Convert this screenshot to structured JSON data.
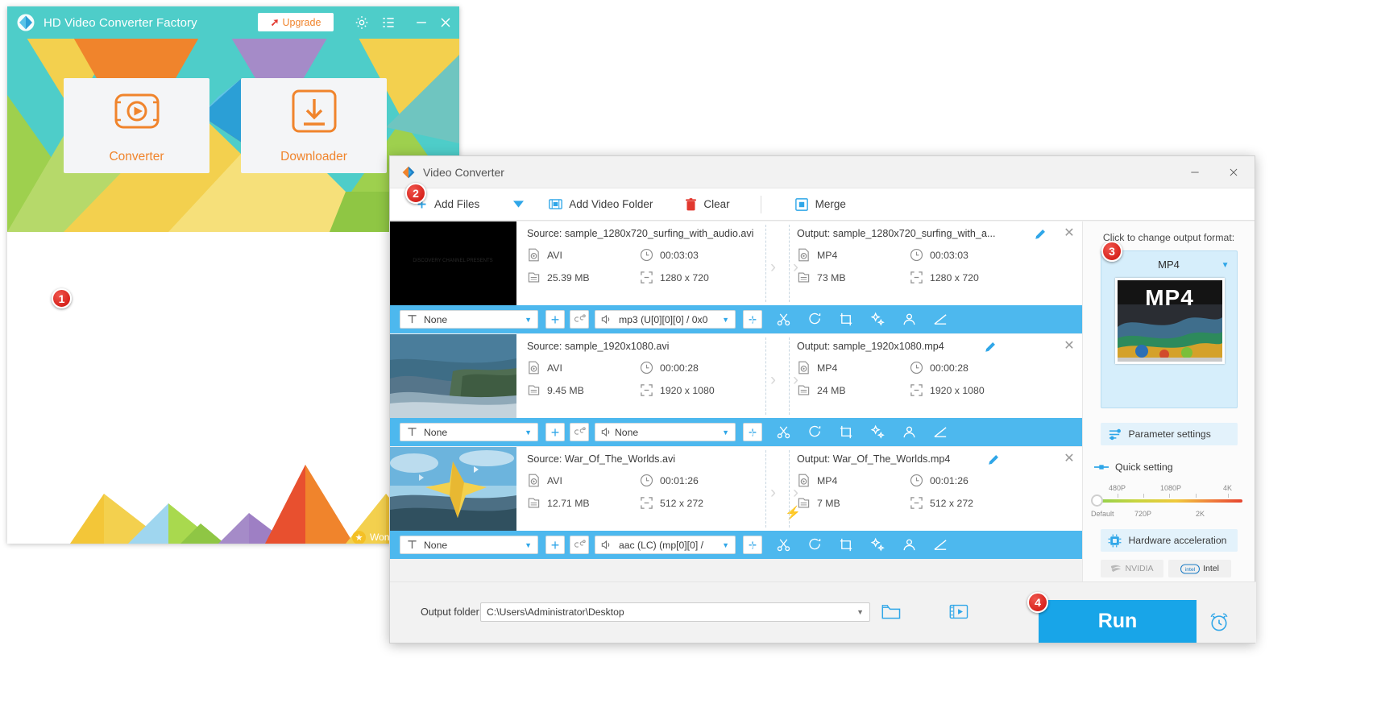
{
  "main_app": {
    "title": "HD Video Converter Factory",
    "upgrade_label": "Upgrade",
    "icons": {
      "logo": "app-logo-icon",
      "settings": "gear-icon",
      "list": "menu-list-icon",
      "minimize": "minimize-icon",
      "close": "close-icon"
    },
    "cards": [
      {
        "label": "Converter",
        "icon": "film-reel-icon"
      },
      {
        "label": "Downloader",
        "icon": "download-arrow-icon"
      }
    ],
    "watermark": "Won",
    "badge_1": "1"
  },
  "converter_window": {
    "title": "Video Converter",
    "minimize_label": "─",
    "close_label": "✕",
    "toolbar": {
      "badge_2": "2",
      "add_files": "Add Files",
      "add_video_folder": "Add Video Folder",
      "clear": "Clear",
      "merge": "Merge"
    },
    "files": [
      {
        "source_label": "Source: sample_1280x720_surfing_with_audio.avi",
        "source_format": "AVI",
        "source_duration": "00:03:03",
        "source_size": "25.39 MB",
        "source_resolution": "1280 x 720",
        "output_label": "Output: sample_1280x720_surfing_with_a...",
        "output_format": "MP4",
        "output_duration": "00:03:03",
        "output_size": "73 MB",
        "output_resolution": "1280 x 720",
        "subtitle_value": "None",
        "audio_value": "mp3 (U[0][0][0] / 0x0",
        "thumb_style": "black",
        "has_bolt": false
      },
      {
        "source_label": "Source: sample_1920x1080.avi",
        "source_format": "AVI",
        "source_duration": "00:00:28",
        "source_size": "9.45 MB",
        "source_resolution": "1920 x 1080",
        "output_label": "Output: sample_1920x1080.mp4",
        "output_format": "MP4",
        "output_duration": "00:00:28",
        "output_size": "24 MB",
        "output_resolution": "1920 x 1080",
        "subtitle_value": "None",
        "audio_value": "None",
        "thumb_style": "coast",
        "has_bolt": false
      },
      {
        "source_label": "Source: War_Of_The_Worlds.avi",
        "source_format": "AVI",
        "source_duration": "00:01:26",
        "source_size": "12.71 MB",
        "source_resolution": "512 x 272",
        "output_label": "Output: War_Of_The_Worlds.mp4",
        "output_format": "MP4",
        "output_duration": "00:01:26",
        "output_size": "7 MB",
        "output_resolution": "512 x 272",
        "subtitle_value": "None",
        "audio_value": "aac (LC) (mp[0][0] /",
        "thumb_style": "sky",
        "has_bolt": true
      }
    ],
    "row_icons": {
      "subtitle": "subtitle-text-icon",
      "add_subtitle": "plus-icon",
      "closed_caption": "closed-caption-icon",
      "audio": "speaker-icon",
      "add_audio": "plus-icon",
      "info": "info-icon",
      "cut": "scissors-icon",
      "rotate": "rotate-icon",
      "crop": "crop-icon",
      "effect": "effects-icon",
      "watermark": "watermark-icon",
      "volume": "volume-curve-icon"
    },
    "right_panel": {
      "badge_3": "3",
      "header": "Click to change output format:",
      "format_name": "MP4",
      "format_thumb_text": "MP4",
      "parameter_settings": "Parameter settings",
      "quick_setting": "Quick setting",
      "slider": {
        "top_labels": [
          "480P",
          "1080P",
          "4K"
        ],
        "bottom_labels": [
          "Default",
          "720P",
          "2K"
        ],
        "value": "Default"
      },
      "hardware_acceleration": "Hardware acceleration",
      "gpus": [
        {
          "name": "NVIDIA",
          "active": false
        },
        {
          "name": "Intel",
          "active": true
        }
      ]
    },
    "bottom": {
      "output_folder_label": "Output folder:",
      "output_folder_path": "C:\\Users\\Administrator\\Desktop",
      "folder_icon": "open-folder-icon",
      "media_icon": "media-player-icon",
      "run_label": "Run",
      "badge_4": "4",
      "alarm_icon": "alarm-clock-icon"
    }
  },
  "colors": {
    "teal": "#4ecdc9",
    "orange": "#f0842c",
    "blue": "#4db8ee",
    "run_blue": "#18a5e8",
    "badge_red": "#d6211a"
  }
}
